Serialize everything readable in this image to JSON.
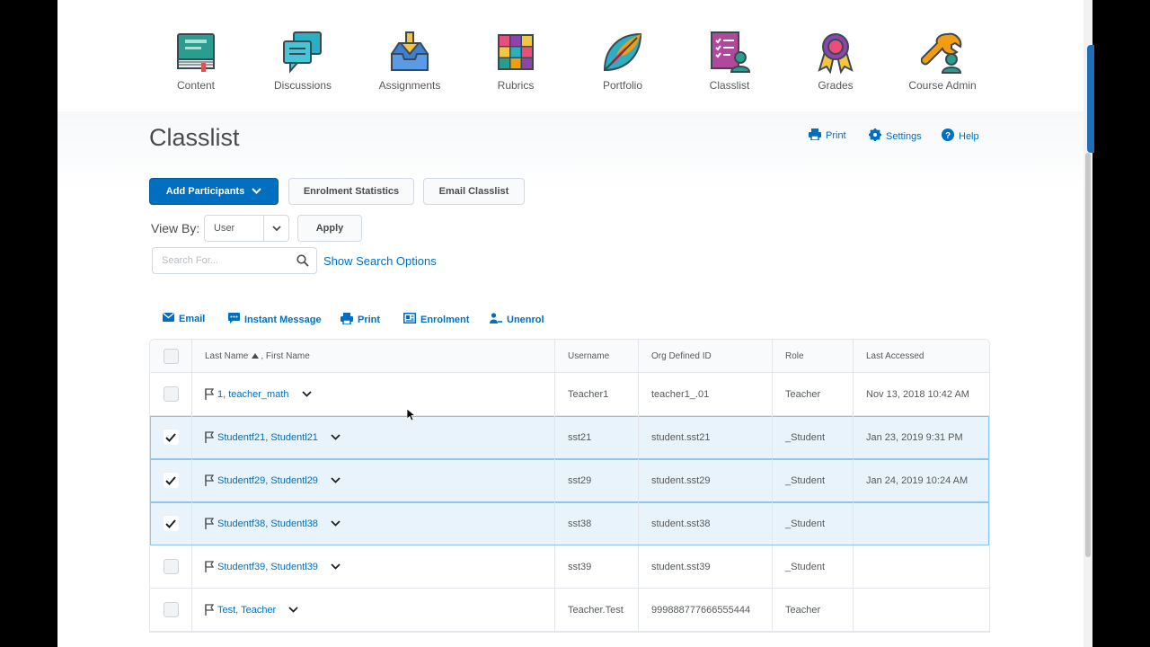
{
  "nav": {
    "items": [
      {
        "label": "Content",
        "icon": "book-icon"
      },
      {
        "label": "Discussions",
        "icon": "speech-bubbles-icon"
      },
      {
        "label": "Assignments",
        "icon": "inbox-download-icon"
      },
      {
        "label": "Rubrics",
        "icon": "grid-tiles-icon"
      },
      {
        "label": "Portfolio",
        "icon": "leaf-icon"
      },
      {
        "label": "Classlist",
        "icon": "classlist-icon"
      },
      {
        "label": "Grades",
        "icon": "award-ribbon-icon"
      },
      {
        "label": "Course Admin",
        "icon": "wrench-person-icon"
      }
    ]
  },
  "page": {
    "title": "Classlist",
    "print_label": "Print",
    "settings_label": "Settings",
    "help_label": "Help"
  },
  "toolbar": {
    "add_participants_label": "Add Participants",
    "enrolment_stats_label": "Enrolment Statistics",
    "email_classlist_label": "Email Classlist"
  },
  "filter": {
    "view_by_label": "View By:",
    "view_by_value": "User",
    "apply_label": "Apply",
    "search_placeholder": "Search For...",
    "show_search_options": "Show Search Options"
  },
  "actions": {
    "email": "Email",
    "instant_message": "Instant Message",
    "print": "Print",
    "enrolment": "Enrolment",
    "unenrol": "Unenrol"
  },
  "table": {
    "headers": {
      "name_last": "Last Name",
      "name_first": ", First Name",
      "username": "Username",
      "org_id": "Org Defined ID",
      "role": "Role",
      "last_accessed": "Last Accessed"
    },
    "rows": [
      {
        "name": "1, teacher_math",
        "username": "Teacher1",
        "org_id": "teacher1_.01",
        "role": "Teacher",
        "last_accessed": "Nov 13, 2018 10:42 AM",
        "selected": false
      },
      {
        "name": "Studentf21, Studentl21",
        "username": "sst21",
        "org_id": "student.sst21",
        "role": "_Student",
        "last_accessed": "Jan 23, 2019 9:31 PM",
        "selected": true
      },
      {
        "name": "Studentf29, Studentl29",
        "username": "sst29",
        "org_id": "student.sst29",
        "role": "_Student",
        "last_accessed": "Jan 24, 2019 10:24 AM",
        "selected": true
      },
      {
        "name": "Studentf38, Studentl38",
        "username": "sst38",
        "org_id": "student.sst38",
        "role": "_Student",
        "last_accessed": "",
        "selected": true
      },
      {
        "name": "Studentf39, Studentl39",
        "username": "sst39",
        "org_id": "student.sst39",
        "role": "_Student",
        "last_accessed": "",
        "selected": false
      },
      {
        "name": "Test, Teacher",
        "username": "Teacher.Test",
        "org_id": "999888777666555444",
        "role": "Teacher",
        "last_accessed": "",
        "selected": false
      }
    ]
  },
  "colors": {
    "accent": "#006fbf",
    "selected_row": "#e8f3fb"
  }
}
